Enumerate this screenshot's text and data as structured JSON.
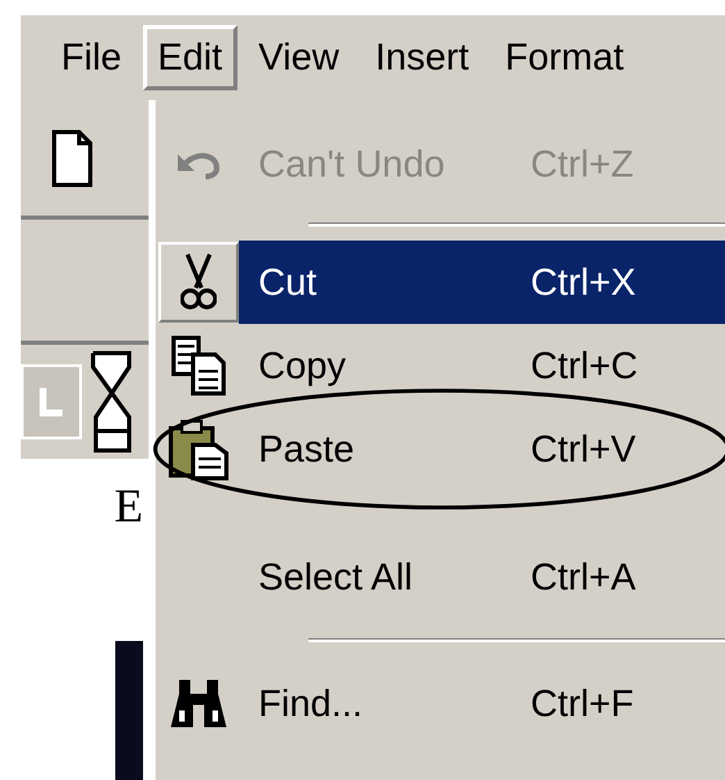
{
  "menu_bar": [
    {
      "label": "File",
      "selected": false
    },
    {
      "label": "Edit",
      "selected": true
    },
    {
      "label": "View",
      "selected": false
    },
    {
      "label": "Insert",
      "selected": false
    },
    {
      "label": "Format",
      "selected": false
    }
  ],
  "document": {
    "text_fragment": "E"
  },
  "edit_menu": [
    {
      "kind": "item",
      "label": "Can't Undo",
      "shortcut": "Ctrl+Z",
      "disabled": true,
      "selected": false,
      "circled": false
    },
    {
      "kind": "separator"
    },
    {
      "kind": "item",
      "label": "Cut",
      "shortcut": "Ctrl+X",
      "disabled": false,
      "selected": true,
      "circled": false
    },
    {
      "kind": "item",
      "label": "Copy",
      "shortcut": "Ctrl+C",
      "disabled": false,
      "selected": false,
      "circled": false
    },
    {
      "kind": "item",
      "label": "Paste",
      "shortcut": "Ctrl+V",
      "disabled": false,
      "selected": false,
      "circled": true
    },
    {
      "kind": "item",
      "label": "Select All",
      "shortcut": "Ctrl+A",
      "disabled": false,
      "selected": false,
      "circled": false
    },
    {
      "kind": "separator"
    },
    {
      "kind": "item",
      "label": "Find...",
      "shortcut": "Ctrl+F",
      "disabled": false,
      "selected": false,
      "circled": false
    }
  ]
}
